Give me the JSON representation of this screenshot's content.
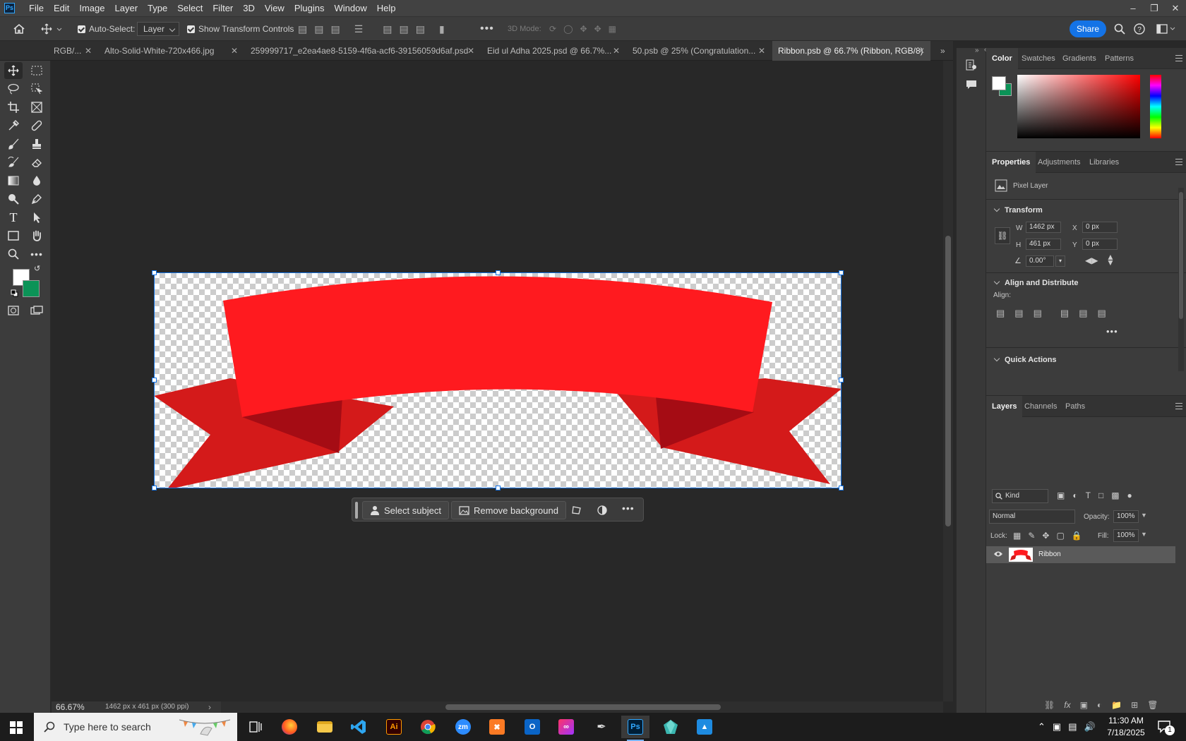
{
  "app": {
    "logo": "Ps"
  },
  "menu": [
    "File",
    "Edit",
    "Image",
    "Layer",
    "Type",
    "Select",
    "Filter",
    "3D",
    "View",
    "Plugins",
    "Window",
    "Help"
  ],
  "options": {
    "auto_select_label": "Auto-Select:",
    "auto_select_value": "Layer",
    "show_transform_label": "Show Transform Controls",
    "mode_3d_label": "3D Mode:",
    "share_label": "Share"
  },
  "tabs": [
    {
      "label": "RGB/...",
      "active": false
    },
    {
      "label": "Alto-Solid-White-720x466.jpg",
      "active": false
    },
    {
      "label": "259999717_e2ea4ae8-5159-4f6a-acf6-39156059d6af.psd",
      "active": false
    },
    {
      "label": "Eid ul Adha 2025.psd @ 66.7%...",
      "active": false
    },
    {
      "label": "50.psb @ 25% (Congratulation...",
      "active": false
    },
    {
      "label": "Ribbon.psb @ 66.7% (Ribbon, RGB/8)",
      "active": true
    }
  ],
  "colors": {
    "foreground": "#ffffff",
    "background": "#0b9357",
    "ribbon_main": "#ff1a1f",
    "ribbon_tail": "#d41a1a",
    "ribbon_fold": "#a50c14",
    "accent": "#1473e6"
  },
  "context_bar": {
    "select_subject": "Select subject",
    "remove_background": "Remove background"
  },
  "status": {
    "zoom": "66.67%",
    "dimensions": "1462 px x 461 px (300 ppi)"
  },
  "color_panel": {
    "tabs": [
      "Color",
      "Swatches",
      "Gradients",
      "Patterns"
    ]
  },
  "properties_panel": {
    "tabs": [
      "Properties",
      "Adjustments",
      "Libraries"
    ],
    "layer_type": "Pixel Layer",
    "transform_title": "Transform",
    "w_label": "W",
    "w_value": "1462 px",
    "h_label": "H",
    "h_value": "461 px",
    "x_label": "X",
    "x_value": "0 px",
    "y_label": "Y",
    "y_value": "0 px",
    "angle_value": "0.00°",
    "align_title": "Align and Distribute",
    "align_label": "Align:",
    "quick_actions_title": "Quick Actions"
  },
  "layers_panel": {
    "tabs": [
      "Layers",
      "Channels",
      "Paths"
    ],
    "kind_label": "Kind",
    "blend_mode": "Normal",
    "opacity_label": "Opacity:",
    "opacity_value": "100%",
    "lock_label": "Lock:",
    "fill_label": "Fill:",
    "fill_value": "100%",
    "layers": [
      {
        "name": "Ribbon",
        "visible": true
      }
    ]
  },
  "taskbar": {
    "search_placeholder": "Type here to search",
    "time": "11:30 AM",
    "date": "7/18/2025",
    "notification_count": "1"
  }
}
